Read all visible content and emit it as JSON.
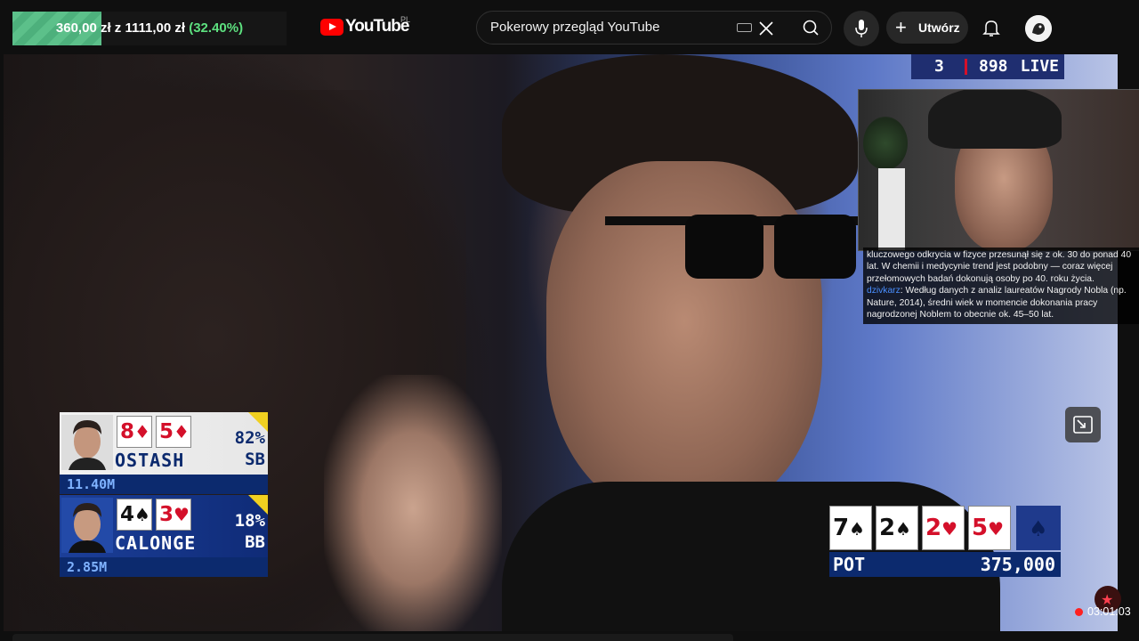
{
  "progress": {
    "current": "360,00 zł",
    "separator": "z",
    "goal": "1111,00 zł",
    "percent": "(32.40%)",
    "fraction": 0.324
  },
  "header": {
    "logo_word": "YouTube",
    "country_code": "PL",
    "search_value": "Pokerowy przegląd YouTube",
    "create_label": "Utwórz",
    "icons": [
      "keyboard-icon",
      "clear-icon",
      "search-icon",
      "mic-icon",
      "plus-icon",
      "bell-icon",
      "avatar"
    ]
  },
  "scoreboard": {
    "value_a": "3",
    "value_b": "898",
    "live_label": "LIVE"
  },
  "chat": {
    "line1": "kluczowego odkrycia w fizyce przesunął się z ok. 30 do ponad 40 lat. W chemii i medycynie trend jest podobny — coraz więcej przełomowych badań dokonują osoby po 40. roku życia.",
    "user": "dzivkarz",
    "message": ": Według danych z analiz laureatów Nagrody Nobla (np. Nature, 2014), średni wiek w momencie dokonania pracy nagrodzonej Noblem to obecnie ok. 45–50 lat."
  },
  "players": [
    {
      "name": "OSTASH",
      "cards": [
        {
          "rank": "8",
          "suit": "♦",
          "color": "#d4102a"
        },
        {
          "rank": "5",
          "suit": "♦",
          "color": "#d4102a"
        }
      ],
      "equity": "82%",
      "position": "SB",
      "stack": "11.40M"
    },
    {
      "name": "CALONGE",
      "cards": [
        {
          "rank": "4",
          "suit": "♠",
          "color": "#111111"
        },
        {
          "rank": "3",
          "suit": "♥",
          "color": "#d4102a"
        }
      ],
      "equity": "18%",
      "position": "BB",
      "stack": "2.85M"
    }
  ],
  "board": {
    "cards": [
      {
        "rank": "7",
        "suit": "♠",
        "color": "#111111"
      },
      {
        "rank": "2",
        "suit": "♠",
        "color": "#111111"
      },
      {
        "rank": "2",
        "suit": "♥",
        "color": "#d4102a"
      },
      {
        "rank": "5",
        "suit": "♥",
        "color": "#d4102a"
      }
    ],
    "pot_label": "POT",
    "pot_value": "375,000"
  },
  "timer": "03:01:03"
}
